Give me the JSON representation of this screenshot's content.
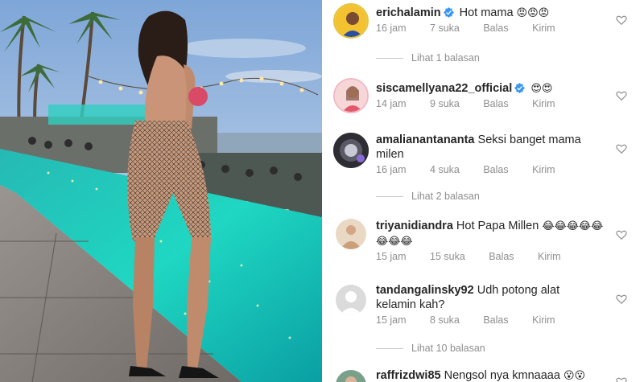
{
  "comments": [
    {
      "username": "erichalamin",
      "verified": true,
      "text": "Hot mama",
      "emoji": "😡😡😡",
      "time": "16 jam",
      "likes": "7 suka",
      "reply_label": "Balas",
      "send_label": "Kirim",
      "view_replies": "Lihat 1 balasan"
    },
    {
      "username": "siscamellyana22_official",
      "verified": true,
      "text": "",
      "emoji": "😍😍",
      "time": "14 jam",
      "likes": "9 suka",
      "reply_label": "Balas",
      "send_label": "Kirim"
    },
    {
      "username": "amalianantananta",
      "verified": false,
      "text": "Seksi banget mama milen",
      "emoji": "",
      "time": "16 jam",
      "likes": "4 suka",
      "reply_label": "Balas",
      "send_label": "Kirim",
      "view_replies": "Lihat 2 balasan"
    },
    {
      "username": "triyanidiandra",
      "verified": false,
      "text": "Hot Papa Millen",
      "emoji": "😂😂😂😂😂😂😂😂",
      "time": "15 jam",
      "likes": "15 suka",
      "reply_label": "Balas",
      "send_label": "Kirim"
    },
    {
      "username": "tandangalinsky92",
      "verified": false,
      "text": "Udh potong alat kelamin kah?",
      "emoji": "",
      "time": "15 jam",
      "likes": "8 suka",
      "reply_label": "Balas",
      "send_label": "Kirim",
      "view_replies": "Lihat 10 balasan"
    },
    {
      "username": "raffrizdwi85",
      "verified": false,
      "text": "Nengsol nya kmnaaaa",
      "emoji": "😮😮"
    }
  ],
  "colors": {
    "verified_badge": "#3897f0",
    "meta_text": "#8e8e8e",
    "heart_outline": "#8e8e8e"
  }
}
